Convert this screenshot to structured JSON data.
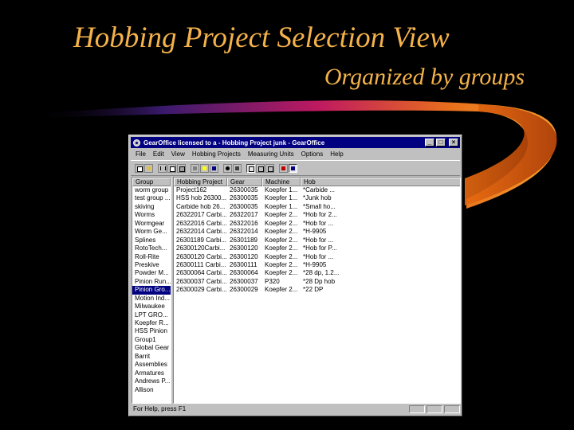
{
  "slide": {
    "title": "Hobbing Project Selection View",
    "subtitle": "Organized by groups"
  },
  "window": {
    "title": "GearOffice licensed to a - Hobbing Project junk - GearOffice",
    "buttons": {
      "minimize": "_",
      "maximize": "□",
      "close": "×"
    },
    "menu": [
      "File",
      "Edit",
      "View",
      "Hobbing Projects",
      "Measuring Units",
      "Options",
      "Help"
    ],
    "toolbar_icons": [
      "new-icon",
      "open-icon",
      "cut-icon",
      "copy-icon",
      "paste-icon",
      "print-icon",
      "context-help-icon",
      "help-icon",
      "settings-icon",
      "machine-icon",
      "view-list-icon",
      "view-group-icon",
      "view-tree-icon",
      "units-metric-icon",
      "units-inch-icon"
    ],
    "groups": {
      "header": "Group",
      "items": [
        "worm group",
        "test group ...",
        "skiving",
        "Worms",
        "Wormgear",
        "Worm Ge...",
        "Splines",
        "RotoTech...",
        "Roll-Rite",
        "Preskive",
        "Powder M...",
        "Pinion Run...",
        "Pinion Gro...",
        "Motion Ind...",
        "Milwaukee",
        "LPT GRO...",
        "Koepfer R...",
        "HSS Pinion",
        "Group1",
        "Global Gear",
        "Barrit",
        "Assemblies",
        "Armatures",
        "Andrews P...",
        "Allison"
      ],
      "selected_index": 12
    },
    "table": {
      "headers": [
        "Hobbing Project",
        "Gear",
        "Machine",
        "Hob"
      ],
      "rows": [
        [
          "Project162",
          "26300035",
          "Koepfer 1...",
          "*Carbide ..."
        ],
        [
          "HSS hob 26300...",
          "26300035",
          "Koepfer 1...",
          "*Junk hob"
        ],
        [
          "Carbide hob 26...",
          "26300035",
          "Koepfer 1...",
          "*Small ho..."
        ],
        [
          "26322017 Carbi...",
          "26322017",
          "Koepfer 2...",
          "*Hob for 2..."
        ],
        [
          "26322016 Carbi...",
          "26322016",
          "Koepfer 2...",
          "*Hob for ..."
        ],
        [
          "26322014 Carbi...",
          "26322014",
          "Koepfer 2...",
          "*H-9905"
        ],
        [
          "26301189 Carbi...",
          "26301189",
          "Koepfer 2...",
          "*Hob for ..."
        ],
        [
          "26300120Carbi...",
          "26300120",
          "Koepfer 2...",
          "*Hob for P..."
        ],
        [
          "26300120 Carbi...",
          "26300120",
          "Koepfer 2...",
          "*Hob for ..."
        ],
        [
          "26300111 Carbi...",
          "26300111",
          "Koepfer 2...",
          "*H-9905"
        ],
        [
          "26300064 Carbi...",
          "26300064",
          "Koepfer 2...",
          "*28 dp, 1.2..."
        ],
        [
          "26300037 Carbi...",
          "26300037",
          "P320",
          "*28 Dp hob"
        ],
        [
          "26300029 Carbi...",
          "26300029",
          "Koepfer 2...",
          "*22 DP"
        ]
      ]
    },
    "status": "For Help, press F1"
  },
  "colors": {
    "title_text": "#f4b24a",
    "background": "#000000",
    "window_face": "#c0c0c0",
    "titlebar": "#000080",
    "selection": "#000080"
  }
}
